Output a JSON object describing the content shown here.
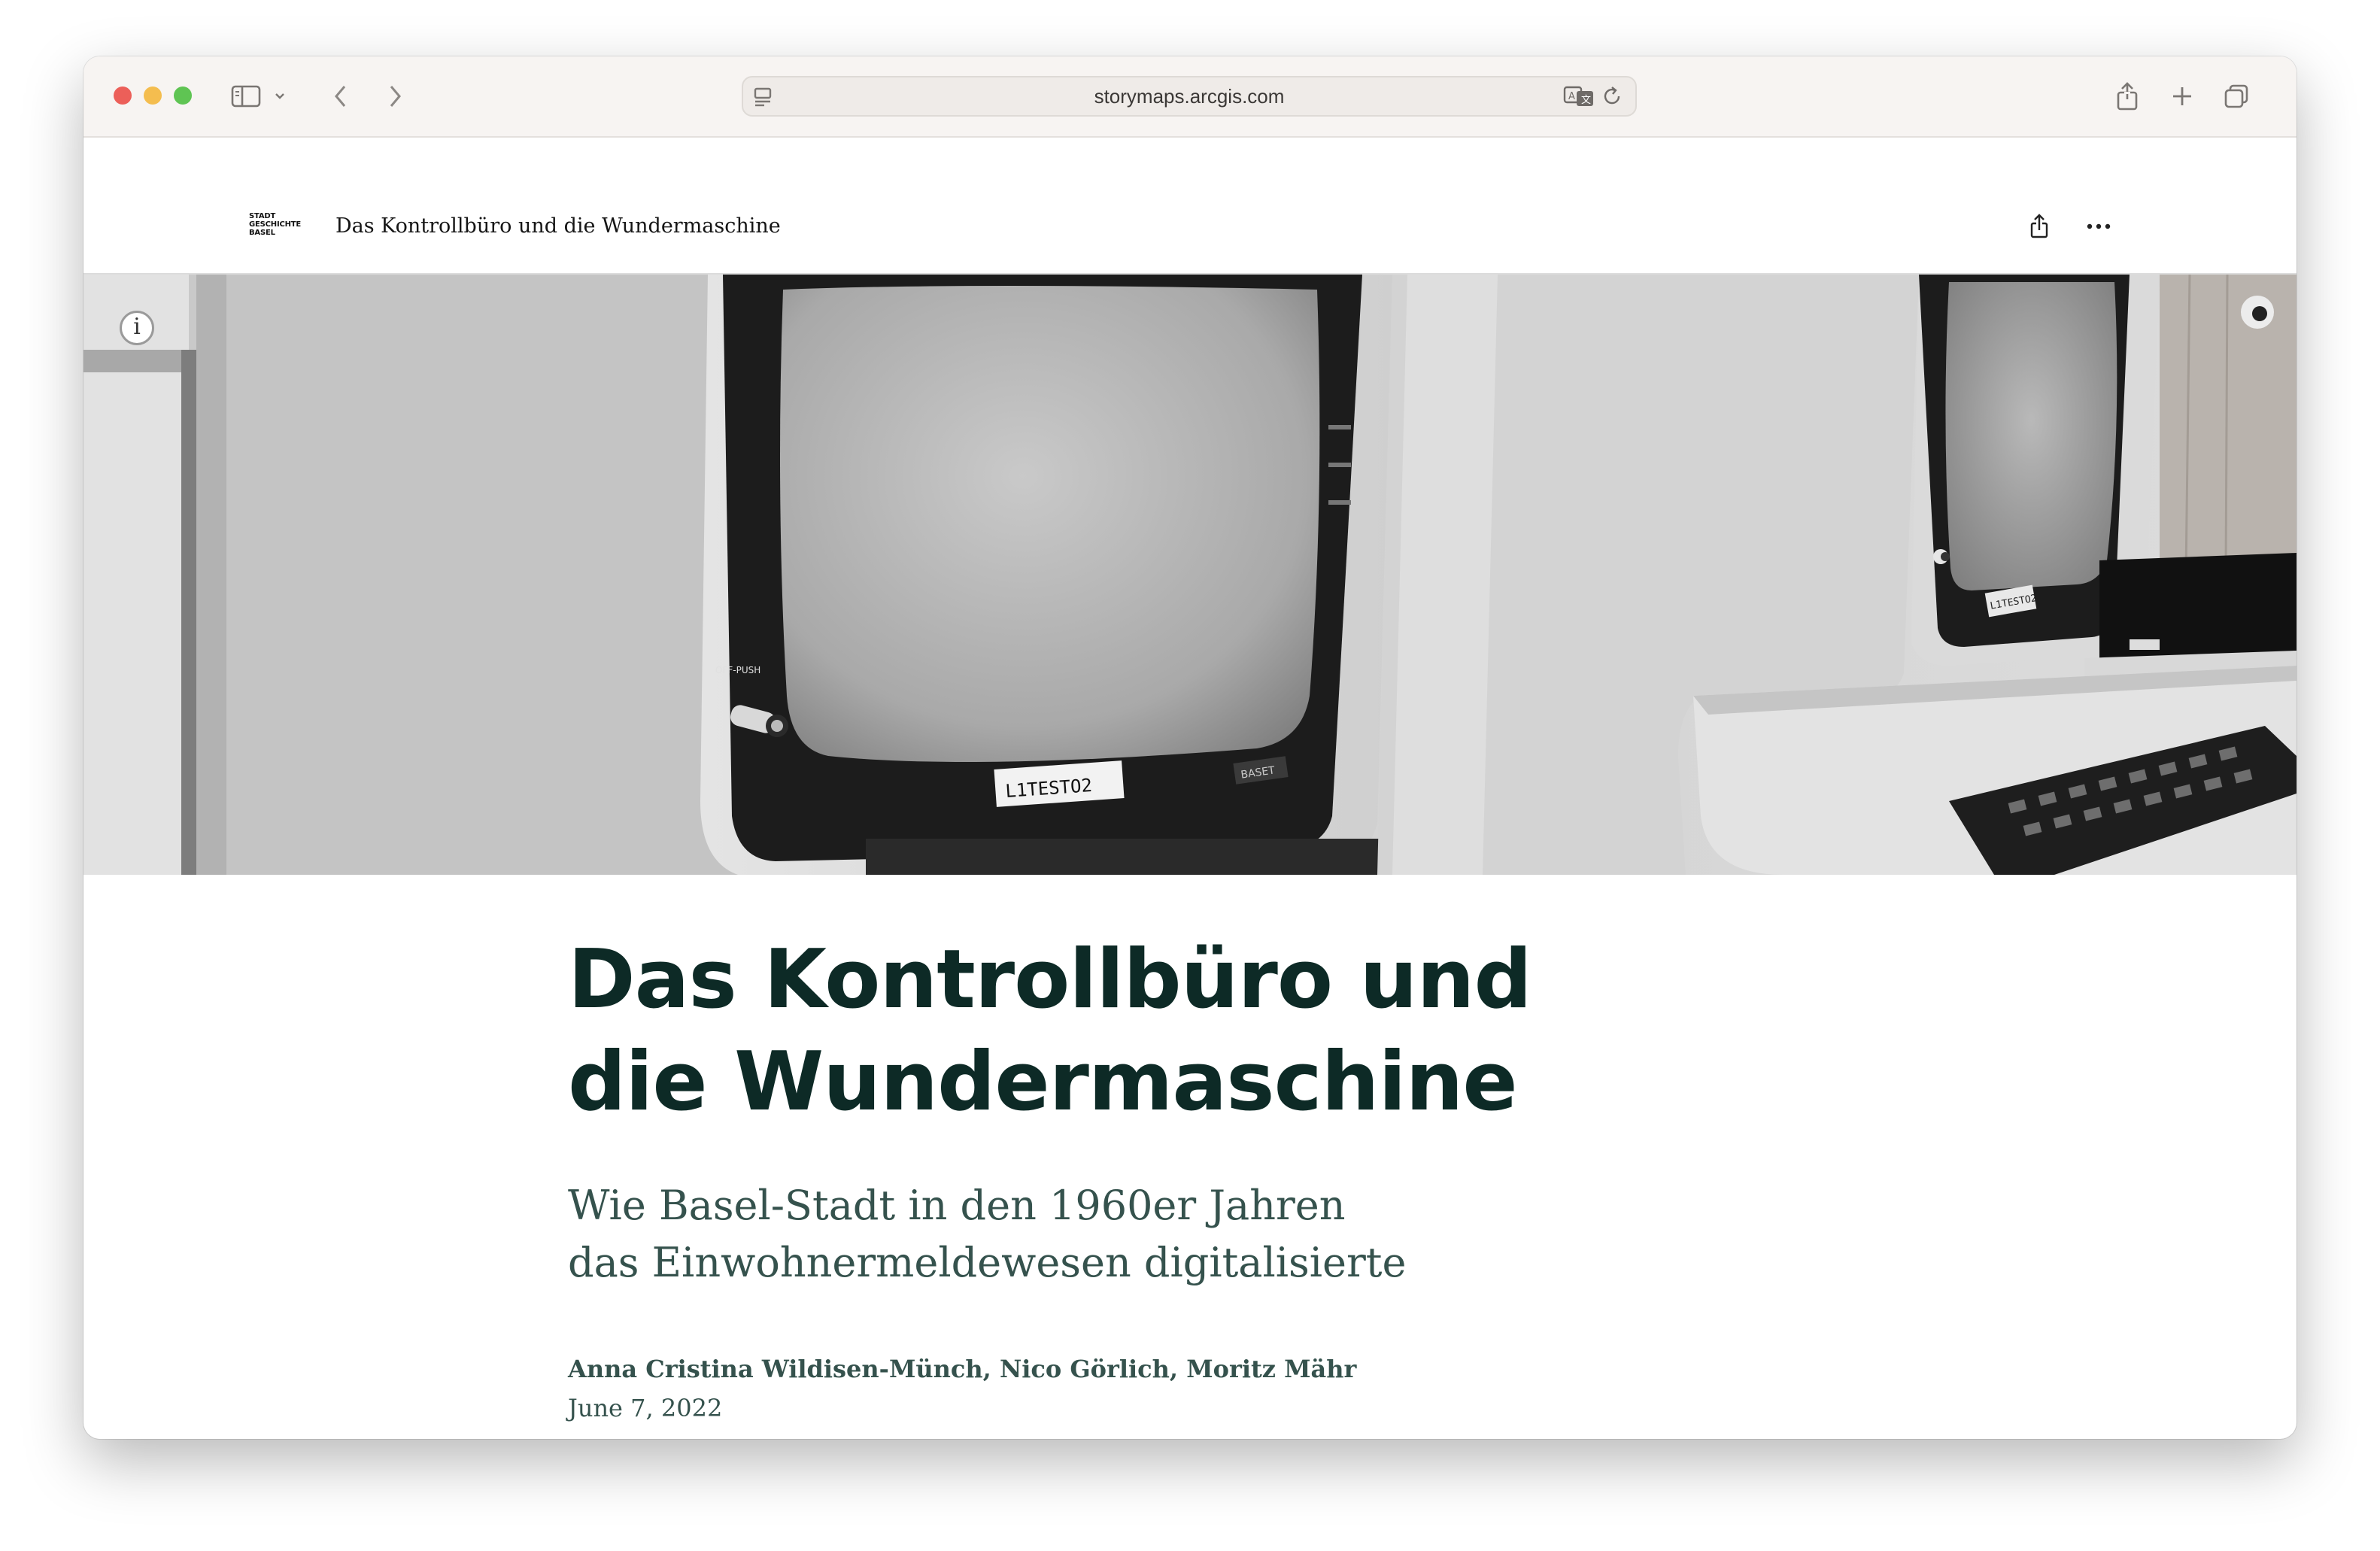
{
  "browser": {
    "url": "storymaps.arcgis.com",
    "icons": [
      "sidebar-icon",
      "chevron-down-icon",
      "back-icon",
      "forward-icon",
      "page-icon",
      "translate-icon",
      "reload-icon",
      "share-icon",
      "plus-icon",
      "tabs-icon"
    ]
  },
  "story_header": {
    "logo_lines": [
      "STADT",
      "GESCHICHTE",
      "BASEL"
    ],
    "title": "Das Kontrollbüro und die Wundermaschine",
    "icons": [
      "share-icon",
      "more-icon"
    ]
  },
  "hero": {
    "info_label": "i",
    "monitor_label_1": "L1TESTO2",
    "monitor_label_2": "L1TESTO2",
    "monitor_badge": "BASET",
    "knob_label": "OFF-PUSH"
  },
  "story": {
    "title_line_1": "Das Kontrollbüro und",
    "title_line_2": "die Wundermaschine",
    "subtitle_line_1": "Wie Basel-Stadt in den 1960er Jahren",
    "subtitle_line_2": "das Einwohnermeldewesen digitalisierte",
    "authors": "Anna Cristina Wildisen-Münch, Nico Görlich, Moritz Mähr",
    "date": "June 7, 2022"
  },
  "colors": {
    "title": "#0d2a26",
    "subtitle": "#35524d",
    "toolbar": "#f7f4f2"
  }
}
